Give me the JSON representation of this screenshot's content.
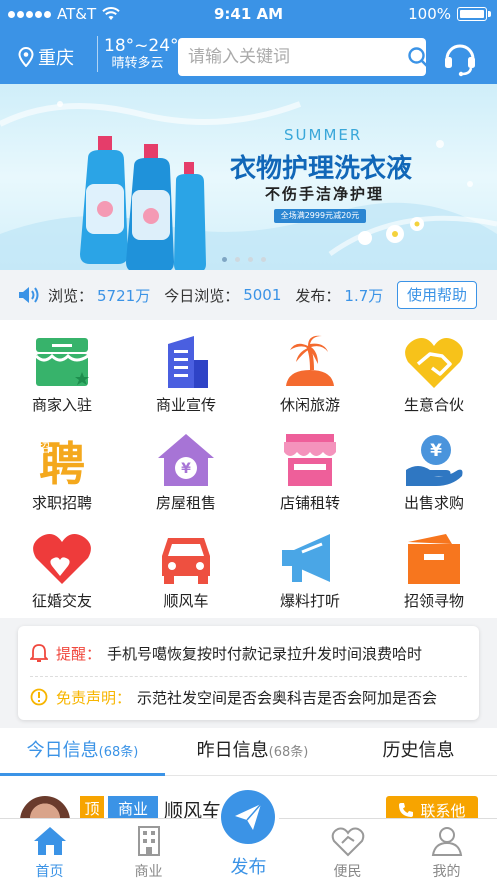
{
  "status_bar": {
    "carrier": "AT&T",
    "time": "9:41 AM",
    "battery": "100%"
  },
  "header": {
    "city": "重庆",
    "temperature": "18°~24°",
    "weather": "晴转多云",
    "search_placeholder": "请输入关键词"
  },
  "banner": {
    "title_en": "SUMMER",
    "title": "衣物护理洗衣液",
    "subtitle": "不伤手洁净护理",
    "promo": "全场满2999元减20元",
    "dots": 4,
    "active_dot": 0
  },
  "stats": {
    "views_label": "浏览：",
    "views": "5721万",
    "today_label": "今日浏览：",
    "today": "5001",
    "posts_label": "发布：",
    "posts": "1.7万",
    "help_button": "使用帮助"
  },
  "categories": [
    {
      "label": "商家入驻",
      "icon": "shop-icon",
      "color": "#37b36b"
    },
    {
      "label": "商业宣传",
      "icon": "building-icon",
      "color": "#4a5fe0"
    },
    {
      "label": "休闲旅游",
      "icon": "island-icon",
      "color": "#f46a2f"
    },
    {
      "label": "生意合伙",
      "icon": "handshake-icon",
      "color": "#f7c21a"
    },
    {
      "label": "求职招聘",
      "icon": "hire-icon",
      "color": "#f4a81d"
    },
    {
      "label": "房屋租售",
      "icon": "house-icon",
      "color": "#a774d6"
    },
    {
      "label": "店铺租转",
      "icon": "storefront-icon",
      "color": "#ee5f9a"
    },
    {
      "label": "出售求购",
      "icon": "money-hand-icon",
      "color": "#4a94dc"
    },
    {
      "label": "征婚交友",
      "icon": "heart-icon",
      "color": "#ee3b3b"
    },
    {
      "label": "顺风车",
      "icon": "car-icon",
      "color": "#ee5040"
    },
    {
      "label": "爆料打听",
      "icon": "megaphone-icon",
      "color": "#4aa6e6"
    },
    {
      "label": "招领寻物",
      "icon": "box-icon",
      "color": "#f7761e"
    }
  ],
  "notices": {
    "reminder_title": "提醒：",
    "reminder_text": "手机号噶恢复按时付款记录拉升发时间浪费哈时",
    "disclaimer_title": "免责声明：",
    "disclaimer_text": "示范社发空间是否会奥科吉是否会阿加是否会"
  },
  "tabs": [
    {
      "label": "今日信息",
      "count": "(68条)"
    },
    {
      "label": "昨日信息",
      "count": "(68条)"
    },
    {
      "label": "历史信息",
      "count": ""
    }
  ],
  "listing": {
    "tag_top": "顶",
    "tag_category": "商业",
    "title": "顺风车",
    "contact_button": "联系他"
  },
  "tabbar": {
    "home": "首页",
    "business": "商业",
    "publish": "发布",
    "service": "便民",
    "mine": "我的"
  },
  "colors": {
    "primary": "#3b93e6",
    "accent": "#f7a400",
    "warning": "#f0483e"
  }
}
